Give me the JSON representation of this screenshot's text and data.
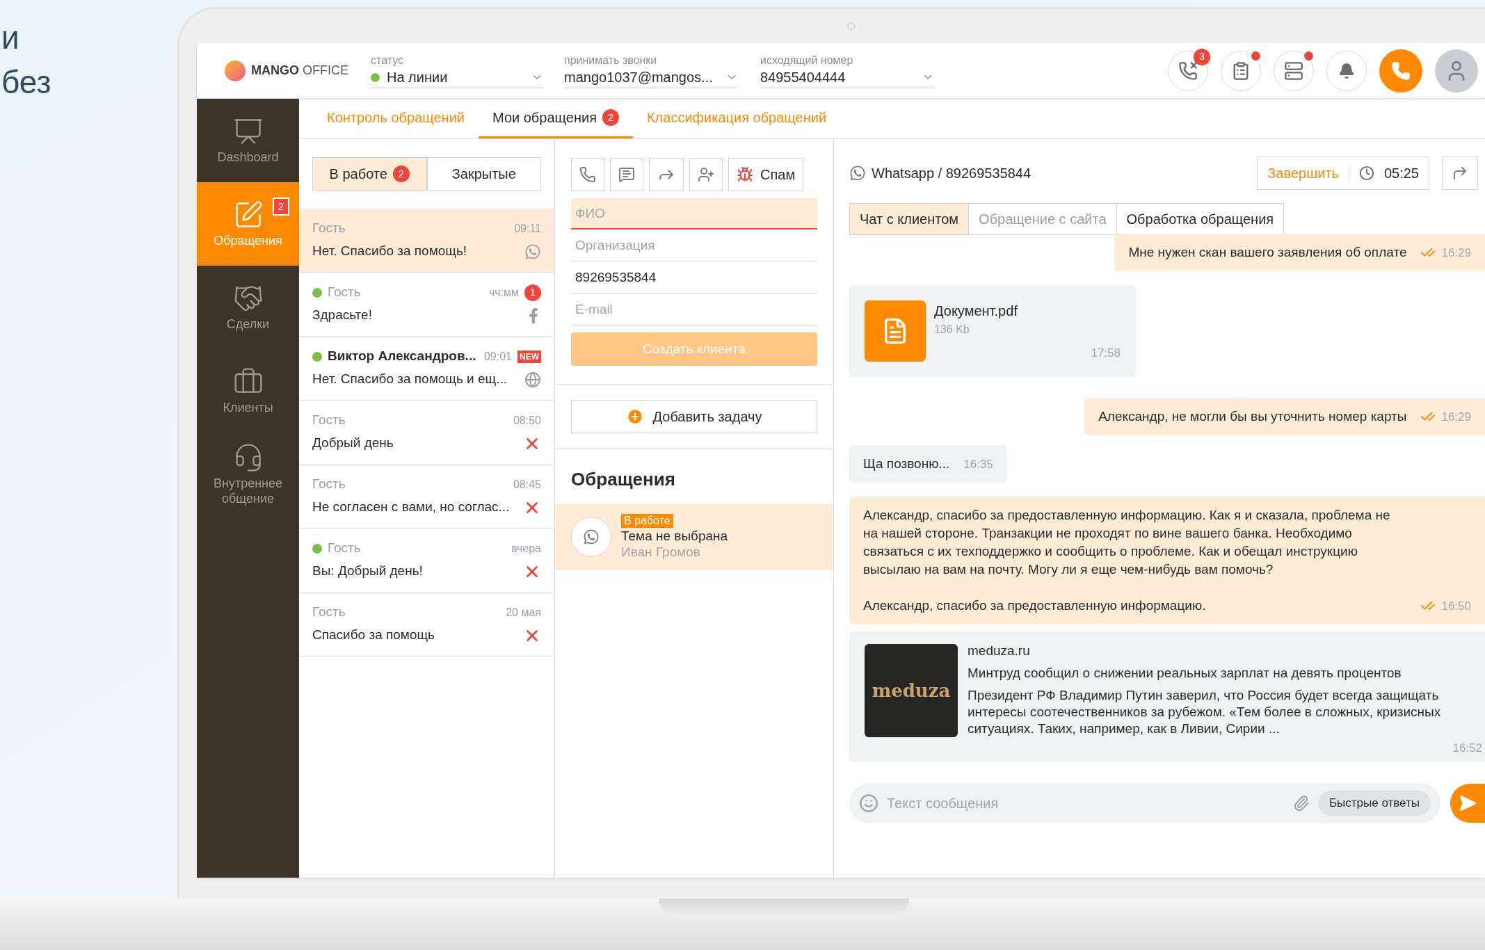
{
  "backdrop_text": [
    "и",
    "без"
  ],
  "header": {
    "logo": {
      "bold": "MANGO",
      "light": "OFFICE"
    },
    "selects": [
      {
        "label": "статус",
        "value": "На линии",
        "color": "#7cc242"
      },
      {
        "label": "принимать звонки",
        "value": "mango1037@mangos..."
      },
      {
        "label": "исходящий номер",
        "value": "84955404444"
      }
    ],
    "actions": [
      {
        "kind": "missed-calls",
        "badge": "3"
      },
      {
        "kind": "clipboard",
        "dot": true
      },
      {
        "kind": "list",
        "dot": true
      },
      {
        "kind": "bell",
        "dot": false
      },
      {
        "kind": "call"
      },
      {
        "kind": "avatar"
      }
    ]
  },
  "sidebar": [
    {
      "kind": "dashboard",
      "label": "Dashboard",
      "selected": false
    },
    {
      "kind": "requests",
      "label": "Обращения",
      "selected": true,
      "badge": "2"
    },
    {
      "kind": "deals",
      "label": "Сделки",
      "selected": false
    },
    {
      "kind": "clients",
      "label": "Клиенты",
      "selected": false
    },
    {
      "kind": "internal",
      "label": "Внутреннее общение",
      "selected": false
    }
  ],
  "tabs": [
    {
      "label": "Контроль обращений",
      "selected": false
    },
    {
      "label": "Мои обращения",
      "selected": true,
      "badge": "2"
    },
    {
      "label": "Классификация обращений",
      "selected": false
    }
  ],
  "filter_tabs": [
    {
      "label": "В работе",
      "selected": true,
      "badge": "2"
    },
    {
      "label": "Закрытые",
      "selected": false
    }
  ],
  "conversations": [
    {
      "name": "Гость",
      "time": "09:11",
      "text": "Нет. Спасибо за помощь!",
      "selected": true,
      "online": false,
      "unread": false,
      "kind": "whatsapp"
    },
    {
      "name": "Гость",
      "time": "чч:мм",
      "text": "Здрасьте!",
      "selected": false,
      "online": true,
      "unread": false,
      "badge": "1",
      "kind": "facebook"
    },
    {
      "name": "Виктор Александров...",
      "time": "09:01",
      "text": "Нет. Спасибо за помощь и ещ...",
      "selected": false,
      "online": true,
      "unread": true,
      "tag": "NEW",
      "kind": "web"
    },
    {
      "name": "Гость",
      "time": "08:50",
      "text": "Добрый день",
      "selected": false,
      "online": false,
      "unread": false,
      "kind": "closed"
    },
    {
      "name": "Гость",
      "time": "08:45",
      "text": "Не согласен с вами, но соглас...",
      "selected": false,
      "online": false,
      "unread": false,
      "kind": "closed"
    },
    {
      "name": "Гость",
      "time": "вчера",
      "text": "Вы: Добрый день!",
      "selected": false,
      "online": true,
      "unread": false,
      "kind": "closed"
    },
    {
      "name": "Гость",
      "time": "20 мая",
      "text": "Спасибо за помощь",
      "selected": false,
      "online": false,
      "unread": false,
      "kind": "closed"
    }
  ],
  "toolbar": [
    {
      "kind": "call"
    },
    {
      "kind": "message"
    },
    {
      "kind": "forward"
    },
    {
      "kind": "add-user"
    },
    {
      "kind": "spam",
      "label": "Спам"
    }
  ],
  "client_form": {
    "fields": [
      {
        "placeholder": "ФИО",
        "invalid": true
      },
      {
        "placeholder": "Организация",
        "invalid": false
      },
      {
        "value": "89269535844",
        "invalid": false
      },
      {
        "placeholder": "E-mail",
        "invalid": false
      }
    ],
    "create_button": {
      "label": "Создать клиента",
      "disabled": true
    }
  },
  "add_task_button": "Добавить задачу",
  "requests": {
    "title": "Обращения",
    "items": [
      {
        "status": "В работе",
        "topic": "Тема не выбрана",
        "person": "Иван Громов",
        "selected": true
      }
    ]
  },
  "chat": {
    "channel": "Whatsapp / 89269535844",
    "finish": "Завершить",
    "timer": "05:25",
    "tabs": [
      {
        "label": "Чат с клиентом",
        "selected": true
      },
      {
        "label": "Обращение с сайта",
        "selected": false
      },
      {
        "label": "Обработка обращения",
        "selected": false
      }
    ],
    "messages": [
      {
        "kind": "text",
        "outgoing": true,
        "text": "Мне нужен скан вашего заявления об оплате",
        "time": "16:29",
        "read": true
      },
      {
        "kind": "file",
        "outgoing": false,
        "name": "Документ.pdf",
        "size": "136 Kb",
        "time": "17:58"
      },
      {
        "kind": "text",
        "outgoing": true,
        "text": "Александр, не могли бы вы уточнить номер карты",
        "time": "16:29",
        "read": true
      },
      {
        "kind": "text",
        "outgoing": false,
        "text": "Ща позвоню...",
        "time": "16:35",
        "read": false
      },
      {
        "kind": "text",
        "outgoing": true,
        "text": "Александр, спасибо за предоставленную информацию. Как я и сказала, проблема не на нашей стороне. Транзакции не проходят по вине вашего банка. Необходимо связаться с их техподдержко и сообщить о проблеме. Как и обещал инструкцию высылаю на вам на почту. Могу ли я еще чем-нибудь вам помочь?\n\nАлександр, спасибо за предоставленную информацию.",
        "time": "16:50",
        "read": true
      },
      {
        "kind": "link",
        "outgoing": false,
        "site": "meduza.ru",
        "thumbnail_text": "meduza",
        "headline": "Минтруд сообщил о снижении реальных зарплат на девять процентов",
        "snippet": "Президент РФ Владимир Путин заверил, что Россия будет всегда защищать интересы соотечественников за рубежом. «Тем более в сложных, кризисных ситуациях. Таких, например, как в Ливии, Сирии ...",
        "time": "16:52"
      }
    ],
    "composer": {
      "placeholder": "Текст сообщения",
      "quick_replies": "Быстрые ответы"
    }
  }
}
